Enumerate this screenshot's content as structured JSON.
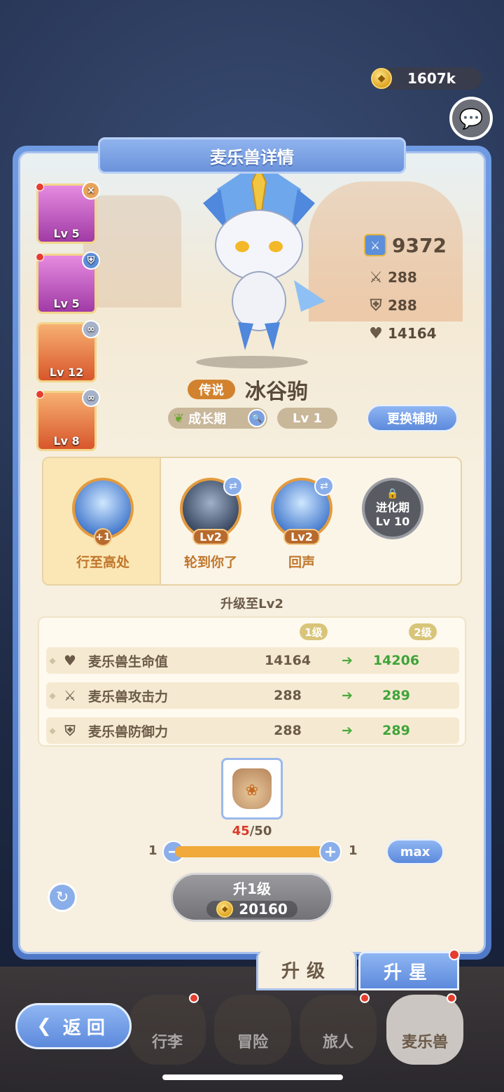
{
  "currency": {
    "amount": "1607k",
    "icon": "gold-coin-icon"
  },
  "panel": {
    "title": "麦乐兽详情"
  },
  "team": [
    {
      "level": "Lv 5",
      "badge": "×",
      "badge_icon": "close-icon",
      "color": "#c94fbf"
    },
    {
      "level": "Lv 5",
      "badge": "⛨",
      "badge_icon": "shield-icon",
      "color": "#c94fbf"
    },
    {
      "level": "Lv 12",
      "badge": "∞",
      "badge_icon": "link-icon",
      "color": "#e77a3a"
    },
    {
      "level": "Lv 8",
      "badge": "∞",
      "badge_icon": "link-icon",
      "color": "#e77a3a"
    }
  ],
  "stats": {
    "power": "9372",
    "attack": "288",
    "defense": "288",
    "hp": "14164"
  },
  "pet": {
    "rarity": "传说",
    "name": "冰谷驹",
    "growth": "成长期",
    "level": "Lv 1"
  },
  "buttons": {
    "swap_assist": "更换辅助",
    "max": "max",
    "back": "返回"
  },
  "skills": [
    {
      "name": "行至高处",
      "badge": "+1"
    },
    {
      "name": "轮到你了",
      "level": "Lv2"
    },
    {
      "name": "回声",
      "level": "Lv2"
    },
    {
      "locked_line1": "进化期",
      "locked_line2": "Lv 10"
    }
  ],
  "upgrade": {
    "title": "升级至Lv2",
    "col_from": "1级",
    "col_to": "2级",
    "rows": [
      {
        "label": "麦乐兽生命值",
        "from": "14164",
        "to": "14206",
        "icon": "heart-icon"
      },
      {
        "label": "麦乐兽攻击力",
        "from": "288",
        "to": "289",
        "icon": "swords-icon"
      },
      {
        "label": "麦乐兽防御力",
        "from": "288",
        "to": "289",
        "icon": "shield-icon"
      }
    ]
  },
  "material": {
    "have": "45",
    "need": "/50",
    "icon": "pet-food-bag-icon"
  },
  "slider": {
    "min": "1",
    "max": "1"
  },
  "upgrade_button": {
    "label": "升1级",
    "cost": "20160"
  },
  "tabs": {
    "upgrade": "升级",
    "star": "升星"
  },
  "nav": {
    "bag": "行李",
    "adventure": "冒险",
    "traveler": "旅人",
    "pets": "麦乐兽"
  }
}
